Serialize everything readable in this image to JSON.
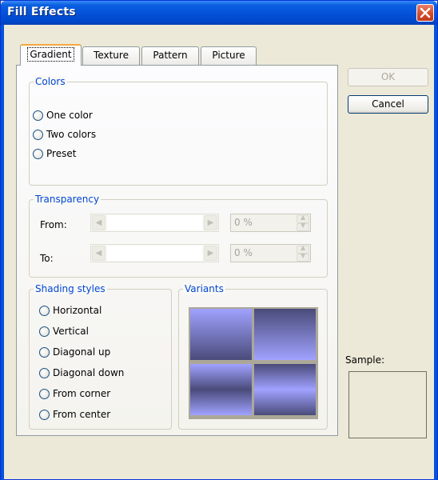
{
  "window": {
    "title": "Fill Effects"
  },
  "tabs": [
    {
      "label": "Gradient",
      "active": true
    },
    {
      "label": "Texture",
      "active": false
    },
    {
      "label": "Pattern",
      "active": false
    },
    {
      "label": "Picture",
      "active": false
    }
  ],
  "colors_group": {
    "title": "Colors",
    "options": [
      "One color",
      "Two colors",
      "Preset"
    ]
  },
  "transparency_group": {
    "title": "Transparency",
    "from_label": "From:",
    "from_value": "0 %",
    "to_label": "To:",
    "to_value": "0 %"
  },
  "shading_group": {
    "title": "Shading styles",
    "options": [
      "Horizontal",
      "Vertical",
      "Diagonal up",
      "Diagonal down",
      "From corner",
      "From center"
    ]
  },
  "variants_group": {
    "title": "Variants",
    "gradient_light": "#a0a2ff",
    "gradient_dark": "#4a4b7a"
  },
  "buttons": {
    "ok": "OK",
    "cancel": "Cancel"
  },
  "sample": {
    "label": "Sample:"
  },
  "colors": {
    "titlebar": "#0553d8",
    "group_title": "#0046d5",
    "close": "#d54a2a"
  }
}
